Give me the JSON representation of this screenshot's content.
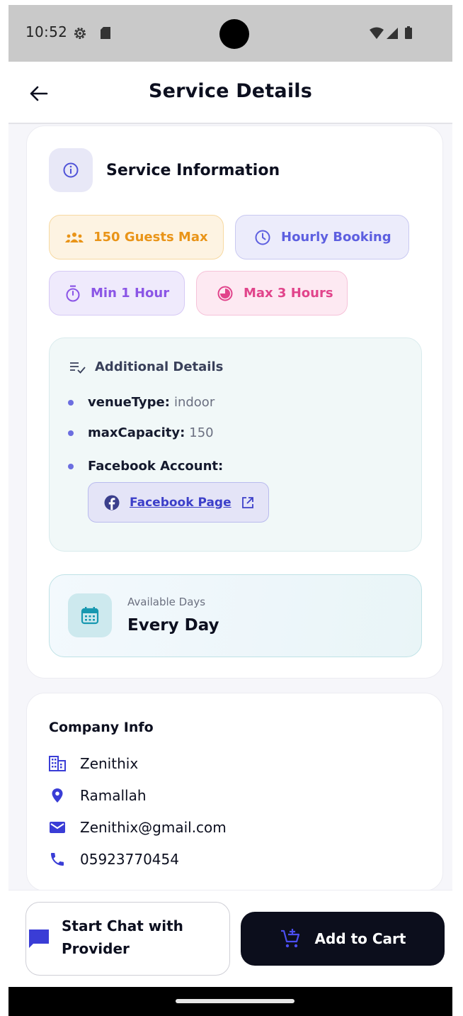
{
  "status_bar": {
    "time": "10:52",
    "icons": [
      "settings-gear-icon",
      "sd-card-icon",
      "wifi-icon",
      "cellular-signal-icon",
      "battery-icon"
    ]
  },
  "app_bar": {
    "back_icon": "arrow-left-icon",
    "title": "Service Details"
  },
  "service_info": {
    "icon": "info-circle-icon",
    "title": "Service Information",
    "chips": [
      {
        "icon": "group-icon",
        "label": "150 Guests Max",
        "color": "#e99418"
      },
      {
        "icon": "clock-icon",
        "label": "Hourly Booking",
        "color": "#5d5fe0"
      },
      {
        "icon": "timer-icon",
        "label": "Min 1 Hour",
        "color": "#8b55e6"
      },
      {
        "icon": "half-circle-icon",
        "label": "Max 3 Hours",
        "color": "#e1448b"
      }
    ],
    "additional_details": {
      "icon": "checklist-icon",
      "title": "Additional Details",
      "items": [
        {
          "key": "venueType:",
          "value": "indoor"
        },
        {
          "key": "maxCapacity:",
          "value": "150"
        },
        {
          "key": "Facebook Account:",
          "value": ""
        }
      ],
      "facebook_link": {
        "icon": "facebook-icon",
        "label": "Facebook Page",
        "trailing_icon": "open-external-icon"
      }
    },
    "available_days": {
      "icon": "calendar-icon",
      "label": "Available Days",
      "value": "Every Day"
    }
  },
  "company_info": {
    "title": "Company Info",
    "name": "Zenithix",
    "location": "Ramallah",
    "email": "Zenithix@gmail.com",
    "phone": "05923770454"
  },
  "actions": {
    "chat_label": "Start Chat with Provider",
    "cart_label": "Add to Cart"
  },
  "colors": {
    "accent": "#5d5fe0",
    "dark_button": "#0c0e1c",
    "link": "#3c3fc9"
  }
}
